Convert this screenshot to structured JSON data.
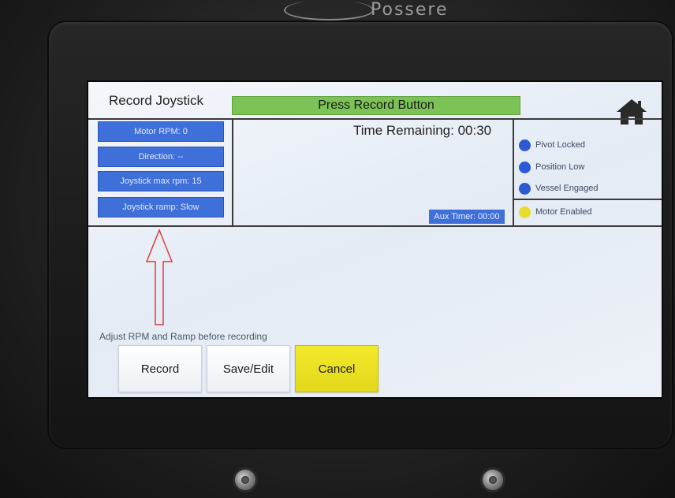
{
  "device": {
    "brand_text": "Possere"
  },
  "screen": {
    "title": "Record Joystick",
    "status_banner": "Press Record Button",
    "time_remaining": "Time Remaining: 00:30",
    "aux_timer": "Aux Timer: 00:00",
    "left_panel": {
      "motor_rpm": "Motor RPM: 0",
      "direction": "Direction: --",
      "joystick_max_rpm": "Joystick max rpm: 15",
      "joystick_ramp": "Joystick ramp: Slow"
    },
    "indicators": [
      {
        "label": "Pivot Locked",
        "color": "#2d58d6"
      },
      {
        "label": "Position Low",
        "color": "#2d58d6"
      },
      {
        "label": "Vessel Engaged",
        "color": "#2d58d6"
      },
      {
        "label": "Motor Enabled",
        "color": "#e8dd28"
      }
    ],
    "hint": "Adjust RPM and Ramp before recording",
    "buttons": {
      "record": "Record",
      "save_edit": "Save/Edit",
      "cancel": "Cancel"
    },
    "icons": {
      "home": "home-icon",
      "arrow": "arrow-up-icon"
    },
    "colors": {
      "banner": "#7dc257",
      "panel_blue": "#3f6fd8",
      "cancel_yellow": "#e8dd28"
    }
  }
}
